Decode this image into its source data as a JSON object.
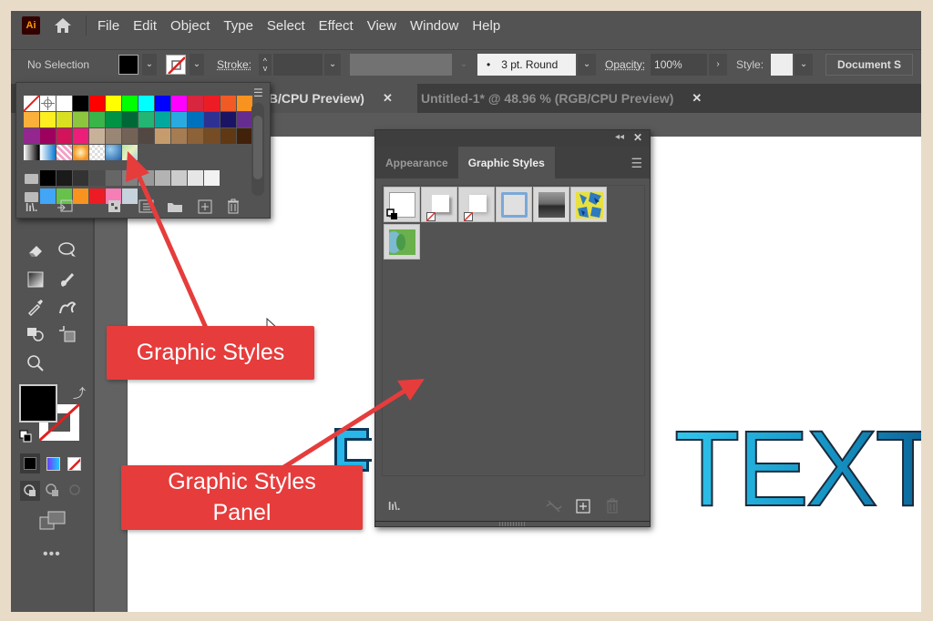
{
  "app": {
    "logo_text": "Ai",
    "menu": [
      "File",
      "Edit",
      "Object",
      "Type",
      "Select",
      "Effect",
      "View",
      "Window",
      "Help"
    ]
  },
  "control_bar": {
    "selection_status": "No Selection",
    "fill_color": "#000000",
    "stroke_label": "Stroke:",
    "brush_value": "3 pt. Round",
    "opacity_label": "Opacity:",
    "opacity_value": "100%",
    "style_label": "Style:",
    "document_setup_label": "Document S"
  },
  "document_tabs": [
    {
      "label": "GB/CPU Preview)",
      "active": true
    },
    {
      "label": "Untitled-1* @ 48.96 % (RGB/CPU Preview)",
      "active": false
    }
  ],
  "swatches_panel": {
    "rows": [
      [
        "none",
        "registration",
        "#ffffff",
        "#000000",
        "#ff0000",
        "#ffff00",
        "#00ff00",
        "#00ffff",
        "#0000ff",
        "#ff00ff",
        "#d7263d",
        "#ed1c24",
        "#f15a24",
        "#f7931e"
      ],
      [
        "#fbb03b",
        "#fcee21",
        "#d9e021",
        "#8cc63f",
        "#39b54a",
        "#009245",
        "#006837",
        "#22b573",
        "#00a99d",
        "#29abe2",
        "#0071bc",
        "#2e3192",
        "#1b1464",
        "#662d91"
      ],
      [
        "#93278f",
        "#9e005d",
        "#d4145a",
        "#ed1e79",
        "#c7b299",
        "#998675",
        "#736357",
        "#534741",
        "#c69c6d",
        "#a67c52",
        "#8c6239",
        "#754c24",
        "#603813",
        "#42210b"
      ],
      [
        "gradient-bw",
        "gradient-blue",
        "pattern-pink",
        "gradient-orange",
        "pattern-check",
        "pattern-blue",
        "pattern-green"
      ]
    ],
    "gray_group": [
      "#000000",
      "#1a1a1a",
      "#333333",
      "#4d4d4d",
      "#666666",
      "#808080",
      "#999999",
      "#b3b3b3",
      "#cccccc",
      "#e6e6e6",
      "#f2f2f2"
    ],
    "color_group": [
      "#42a5f5",
      "#66c24a",
      "#f7931e",
      "#ed1c24",
      "#f57eb6",
      "#c6d3dd"
    ]
  },
  "graphic_styles_panel": {
    "tabs": [
      "Appearance",
      "Graphic Styles"
    ],
    "active_tab": "Graphic Styles",
    "styles": [
      "Default Graphic Style",
      "Drop Shadow",
      "Soft Drop Shadow",
      "Blue Outline",
      "Gradient",
      "Pattern Leaves",
      "Pattern Green"
    ]
  },
  "canvas": {
    "text_visible": "TEXT",
    "text_colors": [
      "#29c5ec",
      "#0a72a8"
    ]
  },
  "callouts": [
    {
      "lines": [
        "Graphic Styles"
      ]
    },
    {
      "lines": [
        "Graphic Styles",
        "Panel"
      ]
    }
  ],
  "colors": {
    "callout": "#e63c3c",
    "ui_bg": "#535353",
    "frame_bg": "#e8dcc8"
  }
}
